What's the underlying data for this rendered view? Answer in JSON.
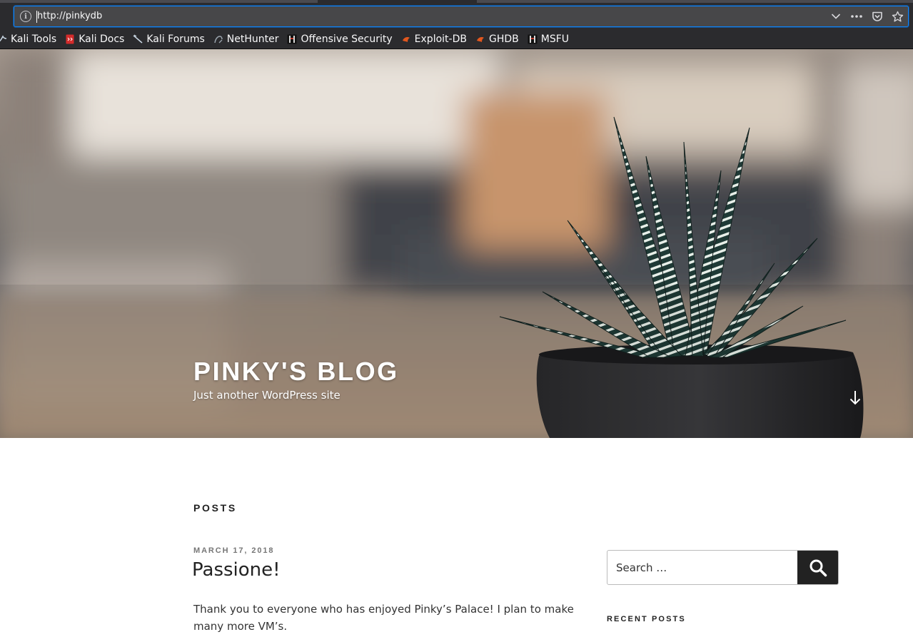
{
  "browser": {
    "url": "http://pinkydb",
    "bookmarks": [
      {
        "label": "Kali Tools",
        "icon": "kali-dragon-icon"
      },
      {
        "label": "Kali Docs",
        "icon": "kali-docs-icon"
      },
      {
        "label": "Kali Forums",
        "icon": "kali-dragon-icon"
      },
      {
        "label": "NetHunter",
        "icon": "nethunter-icon"
      },
      {
        "label": "Offensive Security",
        "icon": "offsec-icon"
      },
      {
        "label": "Exploit-DB",
        "icon": "exploit-db-icon"
      },
      {
        "label": "GHDB",
        "icon": "exploit-db-icon"
      },
      {
        "label": "MSFU",
        "icon": "offsec-icon"
      }
    ],
    "colors": {
      "chrome": "#2b2b2e",
      "urlbar_focus": "#0a84ff"
    }
  },
  "site": {
    "title": "Pinky's Blog",
    "description": "Just another WordPress site"
  },
  "main": {
    "section_heading": "Posts",
    "post": {
      "date": "March 17, 2018",
      "title": "Passione!",
      "excerpt": "Thank you to everyone who has enjoyed Pinky’s Palace! I plan to make many more VM’s."
    }
  },
  "sidebar": {
    "search": {
      "placeholder": "Search …",
      "submit_icon": "search-icon"
    },
    "recent_posts_heading": "Recent Posts"
  }
}
